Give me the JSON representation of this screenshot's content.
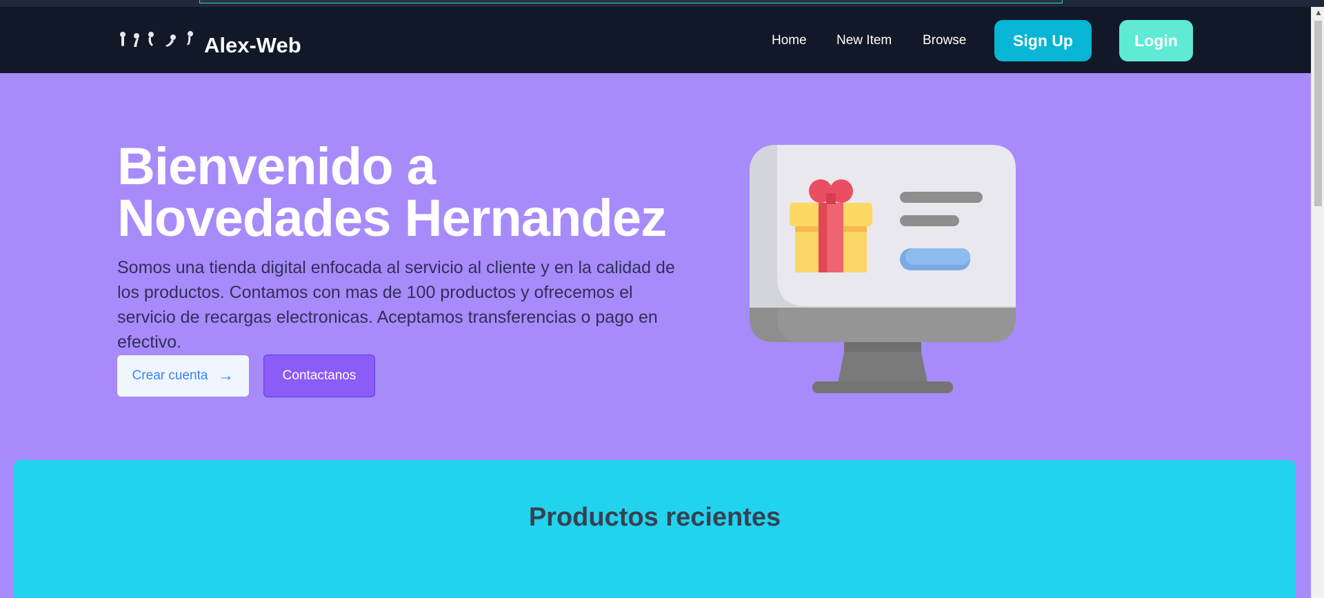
{
  "nav": {
    "brand": "Alex-Web",
    "links": [
      {
        "label": "Home"
      },
      {
        "label": "New Item"
      },
      {
        "label": "Browse"
      }
    ],
    "signup_label": "Sign Up",
    "login_label": "Login"
  },
  "hero": {
    "title_line1": "Bienvenido a",
    "title_line2": "Novedades Hernandez",
    "description": "Somos una tienda digital enfocada al servicio al cliente y en la calidad de los productos. Contamos con mas de 100 productos y ofrecemos el servicio de recargas electronicas. Aceptamos transferencias o pago en efectivo.",
    "create_account_label": "Crear cuenta",
    "contact_label": "Contactanos",
    "illustration_icon": "computer-gift-icon"
  },
  "products": {
    "title": "Productos recientes"
  },
  "colors": {
    "nav_bg": "#111827",
    "hero_bg": "#a78bfa",
    "signup_bg": "#06b6d4",
    "login_bg": "#5eead4",
    "contact_bg": "#8b5cf6",
    "products_bg": "#22d3ee"
  }
}
